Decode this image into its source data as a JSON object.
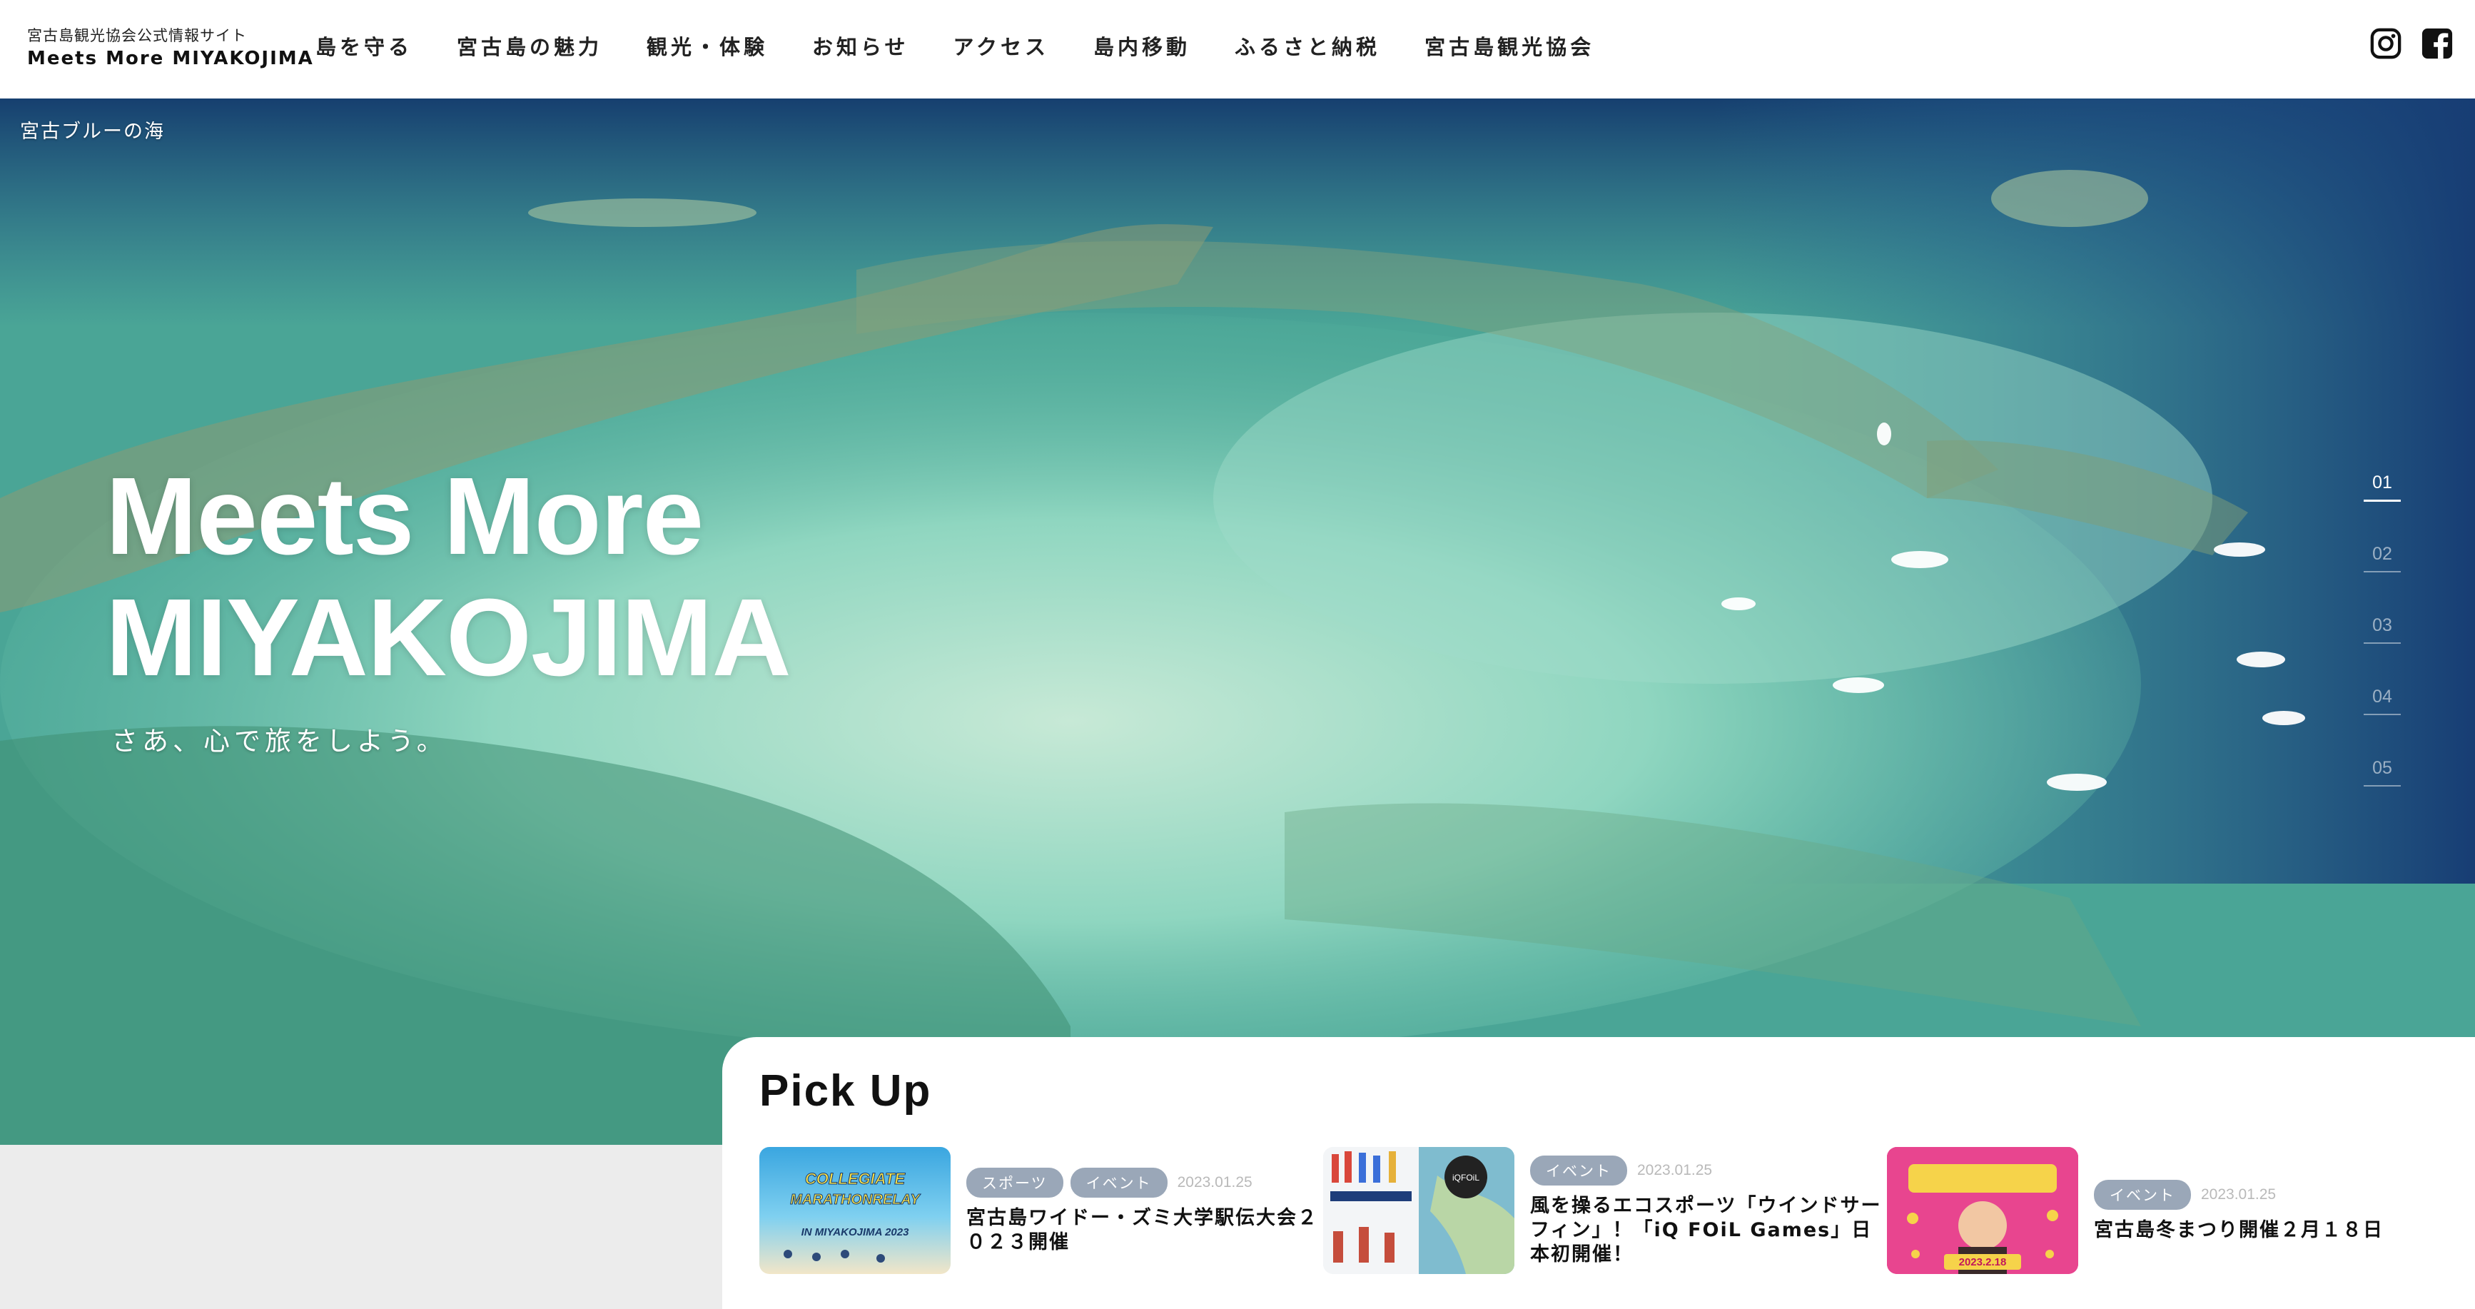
{
  "header": {
    "brand_sub": "宮古島観光協会公式情報サイト",
    "brand_main": "Meets More MIYAKOJIMA",
    "nav": [
      "島を守る",
      "宮古島の魅力",
      "観光・体験",
      "お知らせ",
      "アクセス",
      "島内移動",
      "ふるさと納税",
      "宮古島観光協会"
    ],
    "social": [
      "instagram-icon",
      "facebook-icon"
    ]
  },
  "hero": {
    "caption": "宮古ブルーの海",
    "title_line1": "Meets More",
    "title_line2": "MIYAKOJIMA",
    "tagline": "さあ、心で旅をしよう。",
    "slides": [
      "01",
      "02",
      "03",
      "04",
      "05"
    ],
    "active_slide": "01"
  },
  "pickup": {
    "title": "Pick Up",
    "cards": [
      {
        "tags": [
          "スポーツ",
          "イベント"
        ],
        "date": "2023.01.25",
        "title": "宮古島ワイドー・ズミ大学駅伝大会２０２３開催",
        "thumb_text_1": "COLLEGIATE",
        "thumb_text_2": "MARATHONRELAY",
        "thumb_text_3": "IN MIYAKOJIMA 2023"
      },
      {
        "tags": [
          "イベント"
        ],
        "date": "2023.01.25",
        "title": "風を操るエコスポーツ「ウインドサーフィン」！「iQ FOiL Games」日本初開催！",
        "thumb_text_1": "iQFOiL"
      },
      {
        "tags": [
          "イベント"
        ],
        "date": "2023.01.25",
        "title": "宮古島冬まつり開催２月１８日",
        "thumb_text_1": "2023.2.18"
      }
    ]
  },
  "colors": {
    "accent_tag": "#9aa7b8",
    "header_bg": "#ffffff",
    "pickup_bg": "#ffffff",
    "footer_bg": "#ececec"
  }
}
